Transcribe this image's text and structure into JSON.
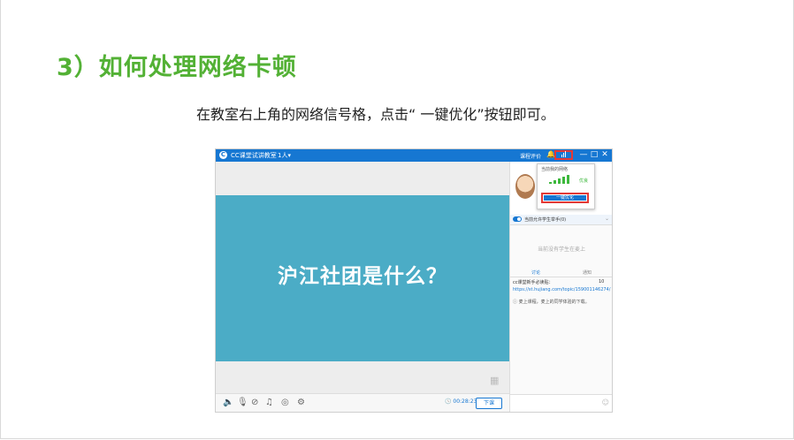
{
  "heading": "3）如何处理网络卡顿",
  "instruction": "在教室右上角的网络信号格，点击“ 一键优化”按钮即可。",
  "app": {
    "name": "CC课堂试讲教室",
    "user_count": "1人▾",
    "eval_link": "课程评价",
    "bell_icon": "🔔",
    "win_min": "—",
    "win_max": "□",
    "win_close": "✕",
    "popup_title": "当前我的网络",
    "network_quality": "优良",
    "optimize_button": "一键优化",
    "allow_hands": "当前允许学生举手(0)",
    "allow_chevron": "⌄",
    "empty_message": "当前没有学生在麦上",
    "tab_discuss": "讨论",
    "tab_notice": "通知",
    "chat_line1": "cc课堂新手必读贴：",
    "chat_line1_tail": "10",
    "chat_link": "https://st.hujiang.com/topic/159001146274/",
    "notice_text": "ⓘ 麦上课程，麦上的同学体验的下载。",
    "slide_text": "沪江社团是什么？",
    "timer": "🕓 00:28:23",
    "leave_button": "下课",
    "toolbar_icons": [
      "🔈",
      "🎙",
      "⊘",
      "♫",
      "◎",
      "⚙"
    ],
    "grid_icon": "▦",
    "send_icon": "☺"
  },
  "colors": {
    "heading": "#53b135",
    "titlebar": "#1677d2",
    "slide": "#4bacc6",
    "highlight": "#e53935"
  }
}
